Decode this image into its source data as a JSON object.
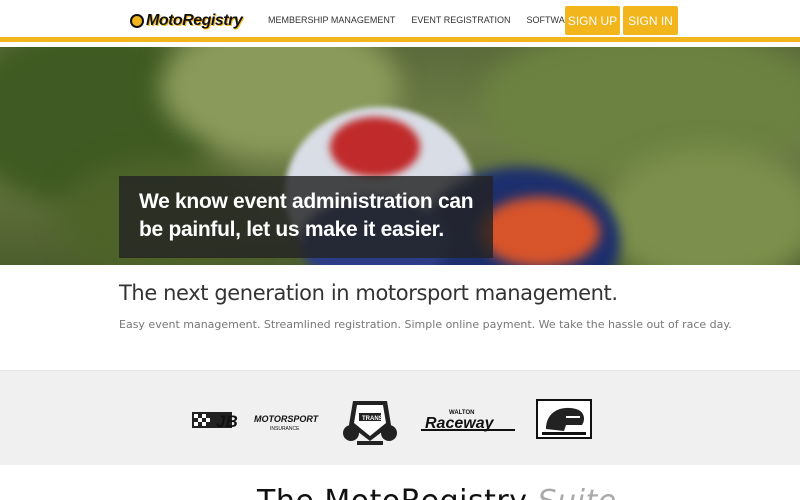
{
  "header": {
    "logo_text": "MotoRegistry",
    "nav": [
      {
        "label": "Membership Management"
      },
      {
        "label": "Event Registration"
      },
      {
        "label": "Software"
      }
    ],
    "signup_label": "Sign Up",
    "signin_label": "Sign In",
    "accent_color": "#f2b51b"
  },
  "hero": {
    "caption": "We know event administration can be painful, let us make it easier."
  },
  "intro": {
    "title": "The next generation in motorsport management.",
    "subtitle": "Easy event management. Streamlined registration. Simple online payment. We take the hassle out of race day."
  },
  "partners": [
    {
      "name": "JB Motorsport Insurance",
      "icon": "jb-motorsport-logo"
    },
    {
      "name": "Walton Trans",
      "icon": "walton-trans-logo"
    },
    {
      "name": "Walton Raceway",
      "icon": "walton-raceway-logo"
    },
    {
      "name": "Helmet logo",
      "icon": "helmet-logo"
    }
  ],
  "suite": {
    "title_main": "The MotoRegistry",
    "title_light": "Suite"
  }
}
